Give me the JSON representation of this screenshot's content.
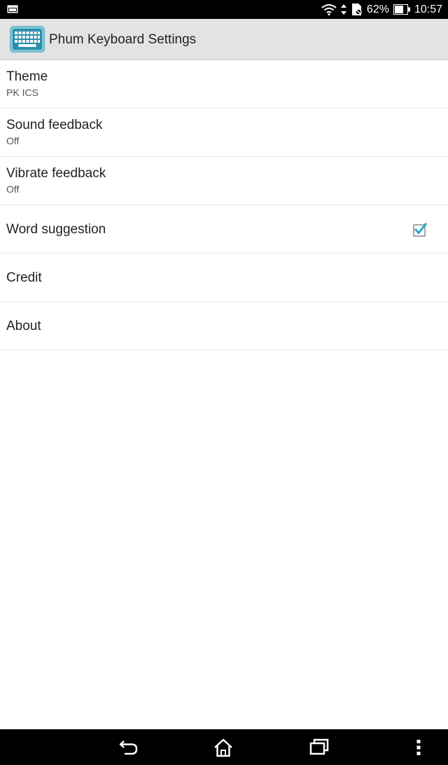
{
  "status_bar": {
    "left_icon": "notification-image-icon",
    "wifi_icon": "wifi-icon",
    "sync_icon": "data-transfer-icon",
    "sim_icon": "no-sim-icon",
    "battery_percent": "62%",
    "battery_icon": "battery-icon",
    "time": "10:57"
  },
  "action_bar": {
    "app_icon": "keyboard-icon",
    "title": "Phum Keyboard Settings",
    "accent_color": "#2aa7c9"
  },
  "preferences": [
    {
      "title": "Theme",
      "summary": "PK ICS"
    },
    {
      "title": "Sound feedback",
      "summary": "Off"
    },
    {
      "title": "Vibrate feedback",
      "summary": "Off"
    },
    {
      "title": "Word suggestion",
      "checked": true
    },
    {
      "title": "Credit"
    },
    {
      "title": "About"
    }
  ],
  "nav_bar": {
    "back_icon": "back-icon",
    "home_icon": "home-icon",
    "recents_icon": "recent-apps-icon",
    "menu_icon": "overflow-menu-icon"
  }
}
